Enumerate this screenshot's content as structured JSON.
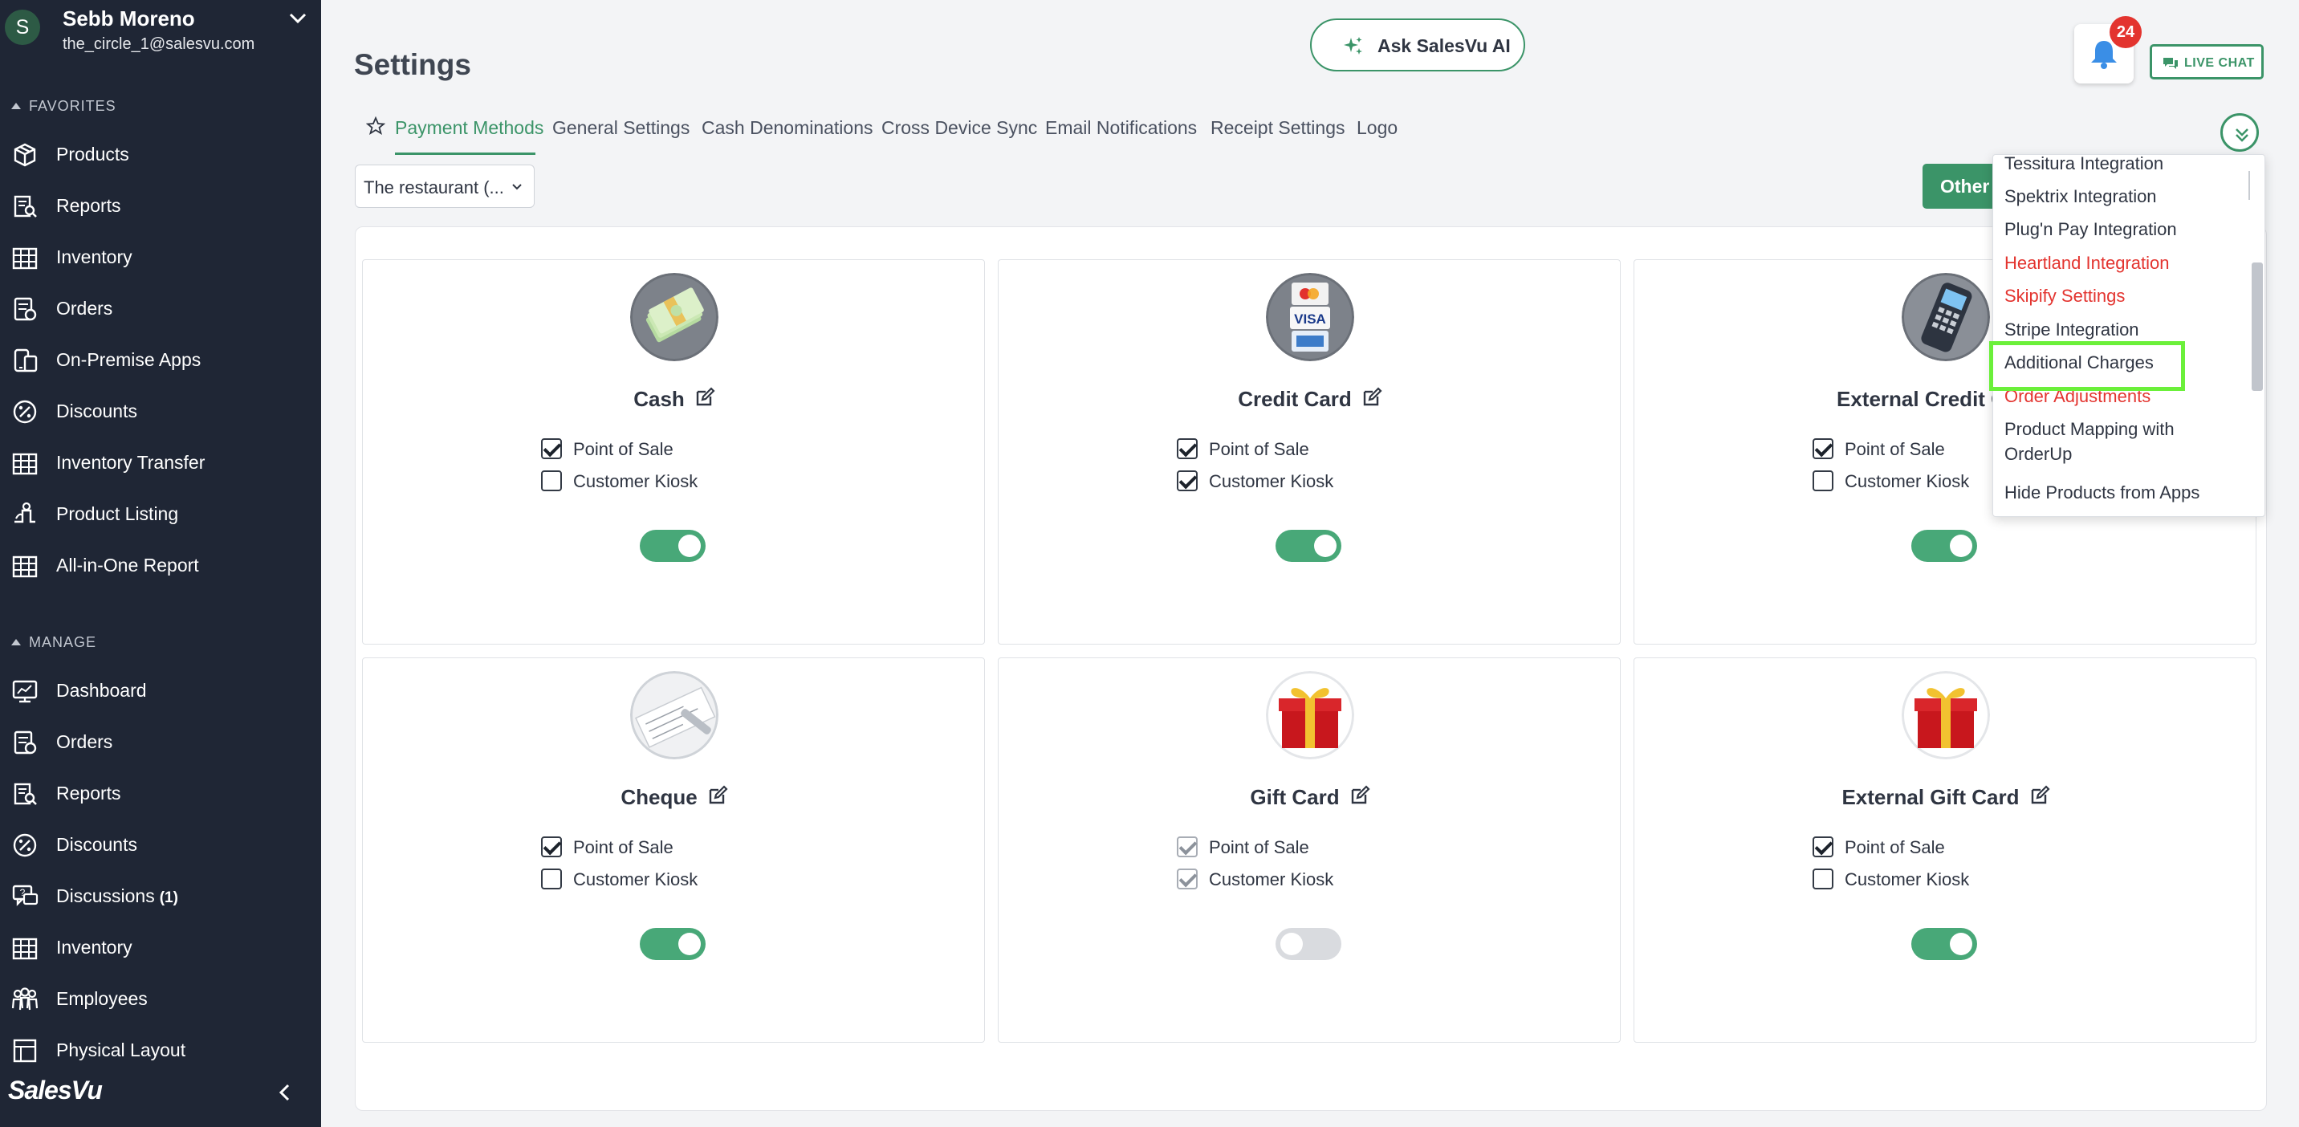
{
  "user": {
    "initial": "S",
    "name": "Sebb Moreno",
    "email": "the_circle_1@salesvu.com"
  },
  "sidebar": {
    "favorites_label": "FAVORITES",
    "favorites": [
      {
        "label": "Products",
        "icon": "box-icon"
      },
      {
        "label": "Reports",
        "icon": "report-icon"
      },
      {
        "label": "Inventory",
        "icon": "inventory-icon"
      },
      {
        "label": "Orders",
        "icon": "orders-icon"
      },
      {
        "label": "On-Premise Apps",
        "icon": "app-icon"
      },
      {
        "label": "Discounts",
        "icon": "discount-icon"
      },
      {
        "label": "Inventory Transfer",
        "icon": "transfer-icon"
      },
      {
        "label": "Product Listing",
        "icon": "listing-icon"
      },
      {
        "label": "All-in-One Report",
        "icon": "all-report-icon"
      }
    ],
    "manage_label": "MANAGE",
    "manage": [
      {
        "label": "Dashboard",
        "icon": "dashboard-icon"
      },
      {
        "label": "Orders",
        "icon": "orders-icon"
      },
      {
        "label": "Reports",
        "icon": "report-icon"
      },
      {
        "label": "Discounts",
        "icon": "discount-icon"
      },
      {
        "label": "Discussions",
        "count": "(1)",
        "icon": "discussion-icon"
      },
      {
        "label": "Inventory",
        "icon": "inventory-icon"
      },
      {
        "label": "Employees",
        "icon": "employees-icon"
      },
      {
        "label": "Physical Layout",
        "icon": "layout-icon"
      }
    ],
    "brand": "SalesVu"
  },
  "header": {
    "title": "Settings",
    "ai_button": "Ask SalesVu AI",
    "notification_count": "24",
    "live_chat": "LIVE CHAT"
  },
  "tabs": [
    {
      "label": "Payment Methods",
      "active": true
    },
    {
      "label": "General Settings"
    },
    {
      "label": "Cash Denominations"
    },
    {
      "label": "Cross Device Sync"
    },
    {
      "label": "Email Notifications"
    },
    {
      "label": "Receipt Settings"
    },
    {
      "label": "Logo"
    }
  ],
  "store_select": {
    "value": "The restaurant (..."
  },
  "other_button": "Other",
  "cards": [
    {
      "title": "Cash",
      "icon": "cash-icon",
      "pos_label": "Point of Sale",
      "pos": true,
      "kiosk_label": "Customer Kiosk",
      "kiosk": false,
      "enabled": true
    },
    {
      "title": "Credit Card",
      "icon": "credit-card-icon",
      "pos_label": "Point of Sale",
      "pos": true,
      "kiosk_label": "Customer Kiosk",
      "kiosk": true,
      "enabled": true
    },
    {
      "title": "External Credit C",
      "icon": "card-terminal-icon",
      "pos_label": "Point of Sale",
      "pos": true,
      "kiosk_label": "Customer Kiosk",
      "kiosk": false,
      "enabled": true
    },
    {
      "title": "Cheque",
      "icon": "cheque-icon",
      "pos_label": "Point of Sale",
      "pos": true,
      "kiosk_label": "Customer Kiosk",
      "kiosk": false,
      "enabled": true
    },
    {
      "title": "Gift Card",
      "icon": "gift-icon",
      "pos_label": "Point of Sale",
      "pos": true,
      "kiosk_label": "Customer Kiosk",
      "kiosk": true,
      "enabled": false
    },
    {
      "title": "External Gift Card",
      "icon": "gift-icon",
      "pos_label": "Point of Sale",
      "pos": true,
      "kiosk_label": "Customer Kiosk",
      "kiosk": false,
      "enabled": true
    }
  ],
  "dropdown": {
    "items": [
      {
        "label": "Tessitura Integration"
      },
      {
        "label": "Spektrix Integration"
      },
      {
        "label": "Plug'n Pay Integration"
      },
      {
        "label": "Heartland Integration",
        "red": true
      },
      {
        "label": "Skipify Settings",
        "red": true
      },
      {
        "label": "Stripe Integration"
      },
      {
        "label": "Additional Charges",
        "highlighted": true
      },
      {
        "label": "Order Adjustments",
        "red": true
      },
      {
        "label": "Product Mapping with OrderUp"
      },
      {
        "label": "Hide Products from Apps"
      }
    ]
  },
  "colors": {
    "sidebar_bg": "#1f2635",
    "accent_green": "#3b9468",
    "toggle_on": "#48a878",
    "alert_red": "#e3342f",
    "highlight": "#6bf03a"
  }
}
